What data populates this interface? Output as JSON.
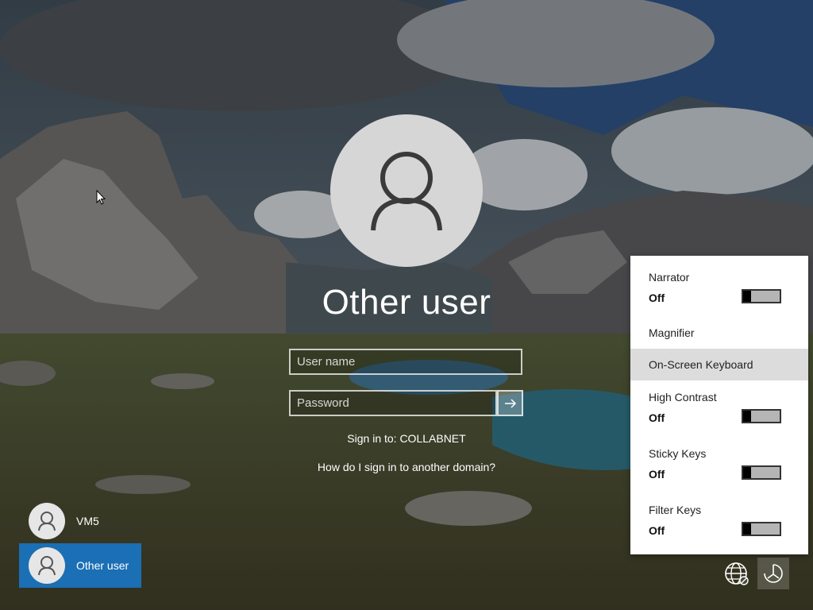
{
  "login": {
    "user_title": "Other user",
    "username_placeholder": "User name",
    "password_placeholder": "Password",
    "sign_in_to": "Sign in to: COLLABNET",
    "help_link": "How do I sign in to another domain?"
  },
  "users": [
    {
      "label": "VM5",
      "selected": false
    },
    {
      "label": "Other user",
      "selected": true
    }
  ],
  "ease_of_access": {
    "narrator": {
      "title": "Narrator",
      "state": "Off"
    },
    "magnifier": {
      "label": "Magnifier"
    },
    "on_screen_keyboard": {
      "label": "On-Screen Keyboard"
    },
    "high_contrast": {
      "title": "High Contrast",
      "state": "Off"
    },
    "sticky_keys": {
      "title": "Sticky Keys",
      "state": "Off"
    },
    "filter_keys": {
      "title": "Filter Keys",
      "state": "Off"
    }
  },
  "icons": {
    "network": "network-icon",
    "ease_of_access": "ease-of-access-icon",
    "power": "power-icon",
    "user": "user-icon",
    "submit": "arrow-right-icon"
  },
  "colors": {
    "accent": "#1b6fb5",
    "panel_bg": "#ffffff",
    "highlight_row": "#dcdcdc"
  }
}
